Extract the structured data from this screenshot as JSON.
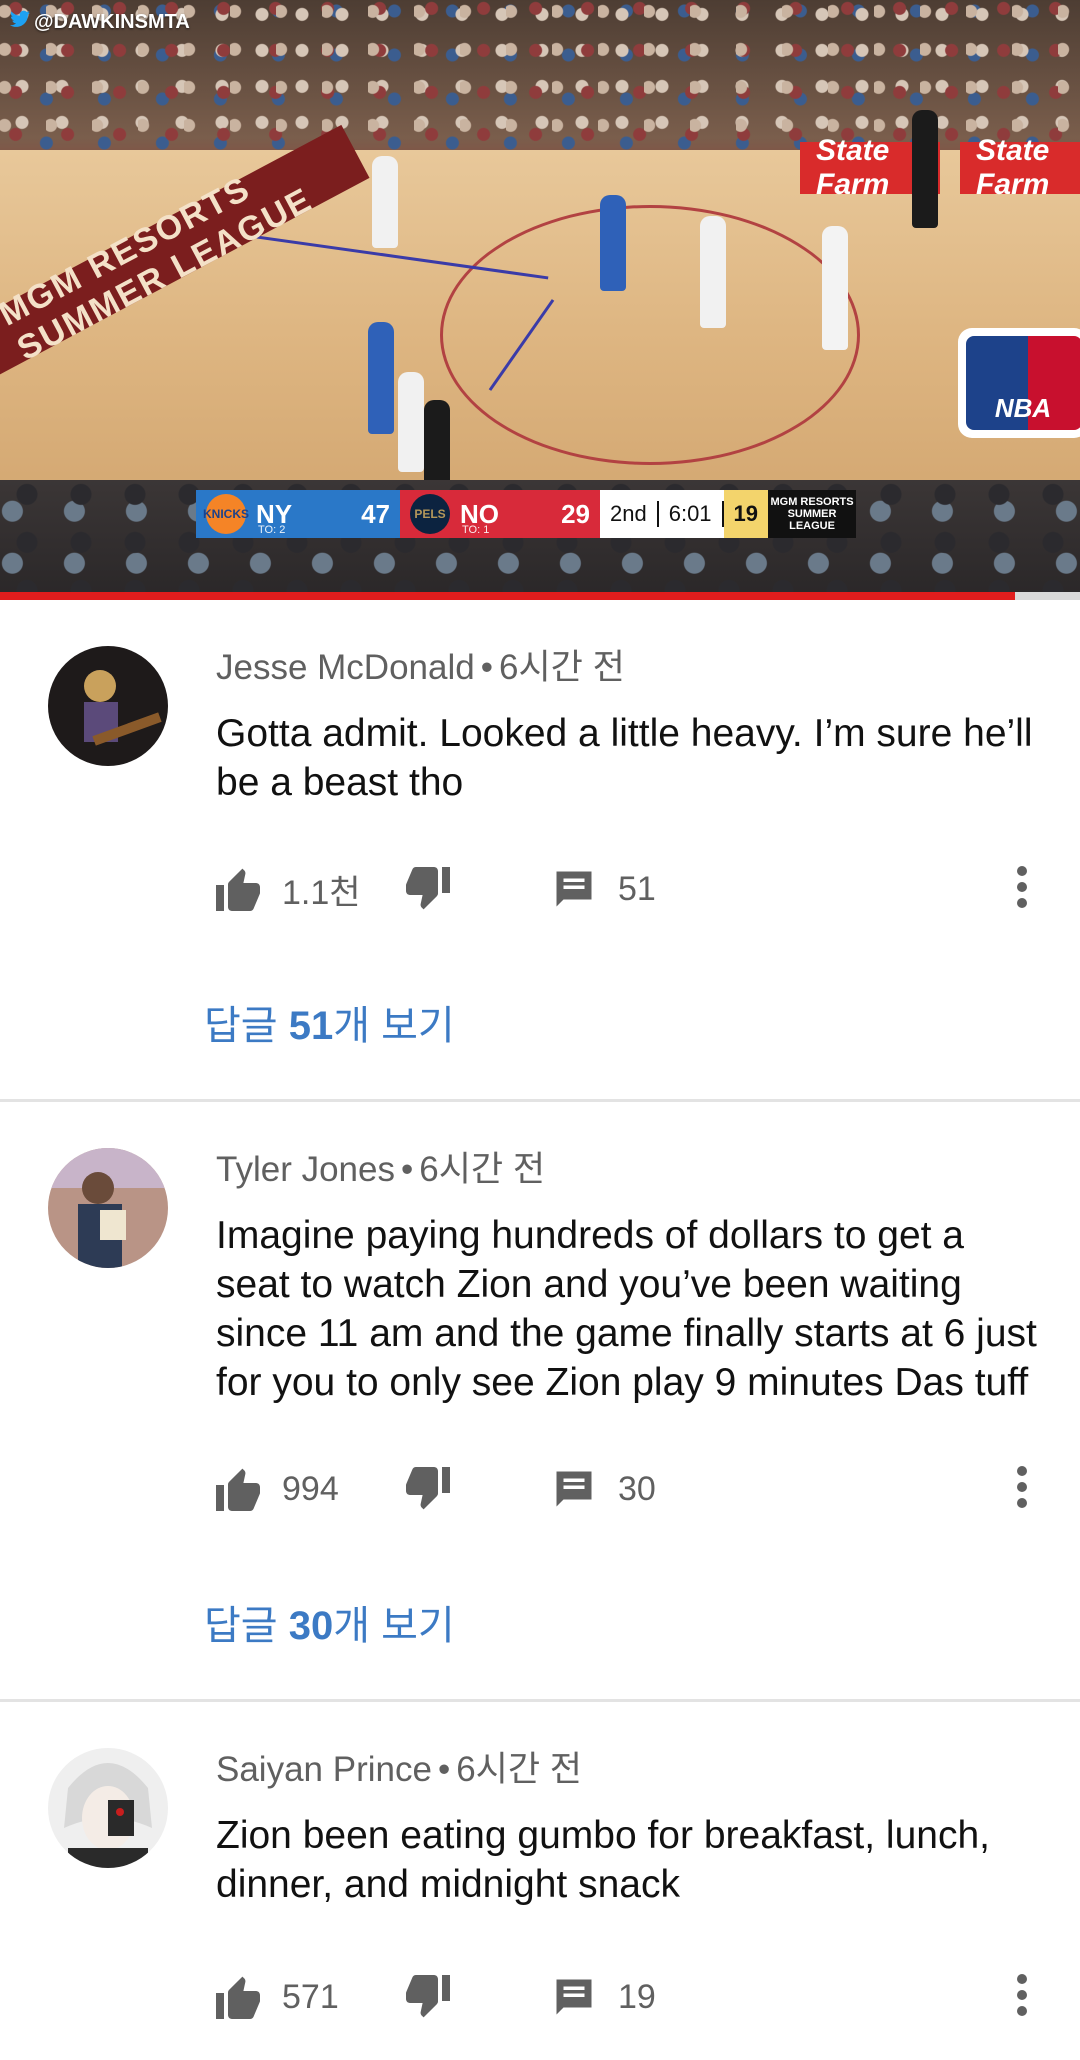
{
  "video": {
    "watermark": "@DAWKINSMTA",
    "court_banner": "MGM RESORTS SUMMER LEAGUE",
    "sponsor": "State Farm",
    "nba_logo_text": "NBA",
    "progress": 0.94,
    "scoreboard": {
      "team_a": {
        "name": "NY",
        "score": "47",
        "timeouts": "TO: 2",
        "badge": "KNICKS",
        "color": "#2a78c8"
      },
      "team_b": {
        "name": "NO",
        "score": "29",
        "timeouts": "TO: 1",
        "badge": "PELS",
        "color": "#d82a3a"
      },
      "period": "2nd",
      "clock": "6:01",
      "shot_clock": "19",
      "league": "MGM RESORTS SUMMER LEAGUE"
    }
  },
  "comments": [
    {
      "author": "Jesse McDonald",
      "time": "6시간 전",
      "text": "Gotta admit. Looked a little heavy. I’m sure he’ll be a beast tho",
      "likes": "1.1천",
      "replies": "51",
      "view_replies_prefix": "답글 ",
      "view_replies_count": "51",
      "view_replies_suffix": "개 보기",
      "avatar_colors": [
        "#1e1a1a",
        "#c9a15c"
      ]
    },
    {
      "author": "Tyler Jones",
      "time": "6시간 전",
      "text": "Imagine paying hundreds of dollars to get a seat to watch Zion and you’ve been waiting since 11 am and the game finally starts at 6 just for you to only see Zion play 9 minutes Das tuff",
      "likes": "994",
      "replies": "30",
      "view_replies_prefix": "답글 ",
      "view_replies_count": "30",
      "view_replies_suffix": "개 보기",
      "avatar_colors": [
        "#b99486",
        "#2d3b55"
      ]
    },
    {
      "author": "Saiyan Prince",
      "time": "6시간 전",
      "text": "Zion been eating gumbo for breakfast, lunch, dinner, and midnight snack",
      "likes": "571",
      "replies": "19",
      "avatar_colors": [
        "#d8d8d8",
        "#2a2a2a"
      ]
    }
  ],
  "colors": {
    "link_blue": "#3c7ac4",
    "meta_gray": "#606060",
    "progress_red": "#e01d1d",
    "divider": "#e3e3e3"
  },
  "icons": [
    "thumbs-up-icon",
    "thumbs-down-icon",
    "comment-icon",
    "more-vert-icon",
    "twitter-bird-icon"
  ]
}
